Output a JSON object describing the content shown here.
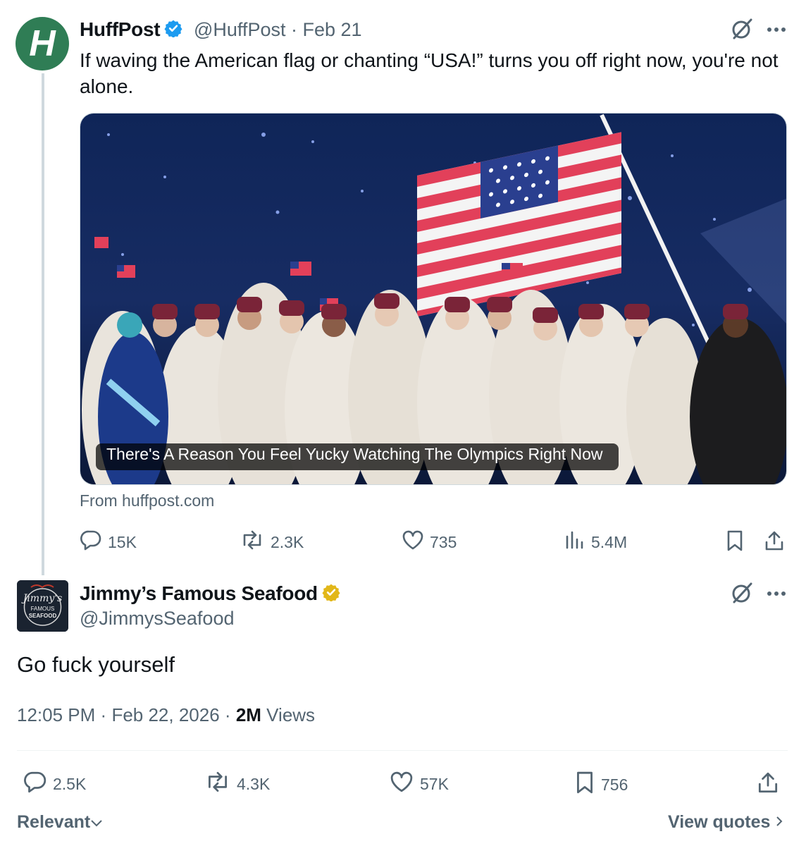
{
  "colors": {
    "brand_huffpost": "#2f7d55",
    "verified_blue": "#1d9bf0",
    "verified_gold": "#e2b719",
    "muted": "#536471"
  },
  "original_tweet": {
    "avatar_letter": "H",
    "display_name": "HuffPost",
    "handle": "@HuffPost",
    "date": "Feb 21",
    "text": "If waving the American flag or chanting “USA!” turns you off right now, you're not alone.",
    "media": {
      "caption": "There's A Reason You Feel Yucky Watching The Olympics Right Now"
    },
    "source": "From huffpost.com",
    "stats": {
      "replies": "15K",
      "reposts": "2.3K",
      "likes": "735",
      "views": "5.4M"
    }
  },
  "quote_tweet": {
    "display_name": "Jimmy’s Famous Seafood",
    "handle": "@JimmysSeafood",
    "avatar_text": {
      "script": "Jimmy's",
      "line2": "FAMOUS",
      "line3": "SEAFOOD"
    },
    "text": "Go fuck yourself",
    "time": "12:05 PM",
    "date": "Feb 22, 2026",
    "views_count": "2M",
    "views_label": "Views",
    "stats": {
      "replies": "2.5K",
      "reposts": "4.3K",
      "likes": "57K",
      "bookmarks": "756"
    }
  },
  "footer": {
    "sort_label": "Relevant",
    "view_quotes": "View quotes"
  }
}
